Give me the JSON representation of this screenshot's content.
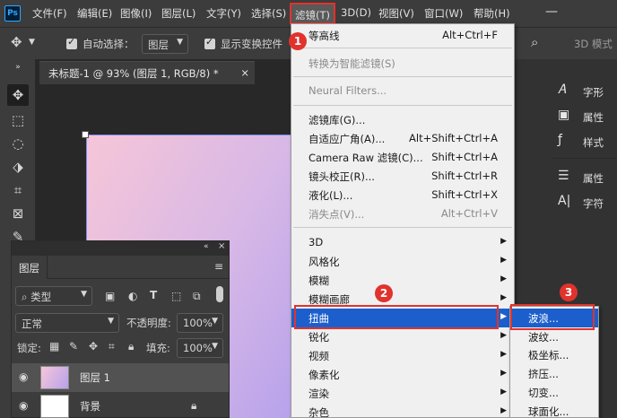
{
  "app": {
    "logo": "Ps"
  },
  "menubar": {
    "items": [
      "文件(F)",
      "编辑(E)",
      "图像(I)",
      "图层(L)",
      "文字(Y)",
      "选择(S)",
      "滤镜(T)",
      "3D(D)",
      "视图(V)",
      "窗口(W)",
      "帮助(H)"
    ]
  },
  "options": {
    "auto_select_label": "自动选择：",
    "auto_select_value": "图层",
    "show_transform_label": "显示变换控件",
    "mode_3d_label": "3D 模式"
  },
  "document": {
    "tab_title": "未标题-1 @ 93% (图层 1, RGB/8) *",
    "close": "×"
  },
  "filter_menu": {
    "items": [
      {
        "label": "等高线",
        "shortcut": "Alt+Ctrl+F"
      },
      {
        "label": "转换为智能滤镜(S)",
        "disabled": true
      },
      {
        "label": "Neural Filters...",
        "disabled": true
      },
      {
        "label": "滤镜库(G)..."
      },
      {
        "label": "自适应广角(A)...",
        "shortcut": "Alt+Shift+Ctrl+A"
      },
      {
        "label": "Camera Raw 滤镜(C)...",
        "shortcut": "Shift+Ctrl+A"
      },
      {
        "label": "镜头校正(R)...",
        "shortcut": "Shift+Ctrl+R"
      },
      {
        "label": "液化(L)...",
        "shortcut": "Shift+Ctrl+X"
      },
      {
        "label": "消失点(V)...",
        "shortcut": "Alt+Ctrl+V",
        "disabled": true
      },
      {
        "label": "3D",
        "submenu": true
      },
      {
        "label": "风格化",
        "submenu": true
      },
      {
        "label": "模糊",
        "submenu": true
      },
      {
        "label": "模糊画廊",
        "submenu": true
      },
      {
        "label": "扭曲",
        "submenu": true,
        "highlighted": true
      },
      {
        "label": "锐化",
        "submenu": true
      },
      {
        "label": "视频",
        "submenu": true
      },
      {
        "label": "像素化",
        "submenu": true
      },
      {
        "label": "渲染",
        "submenu": true
      },
      {
        "label": "杂色",
        "submenu": true
      }
    ]
  },
  "distort_submenu": {
    "items": [
      "波浪...",
      "波纹...",
      "极坐标...",
      "挤压...",
      "切变...",
      "球面化..."
    ]
  },
  "layers_panel": {
    "tab": "图层",
    "filter_label": "类型",
    "blend_mode": "正常",
    "opacity_label": "不透明度:",
    "opacity_value": "100%",
    "lock_label": "锁定:",
    "fill_label": "填充:",
    "fill_value": "100%",
    "layers": [
      {
        "name": "图层 1",
        "selected": true
      },
      {
        "name": "背景",
        "locked": true
      }
    ]
  },
  "right_panel": {
    "items": [
      "字形",
      "属性",
      "样式",
      "属性",
      "字符"
    ]
  },
  "annotations": {
    "badges": [
      "1",
      "2",
      "3"
    ]
  },
  "colors": {
    "highlight": "#1c5fcc",
    "annotation_red": "#e0332d",
    "ps_blue": "#31a8ff"
  }
}
